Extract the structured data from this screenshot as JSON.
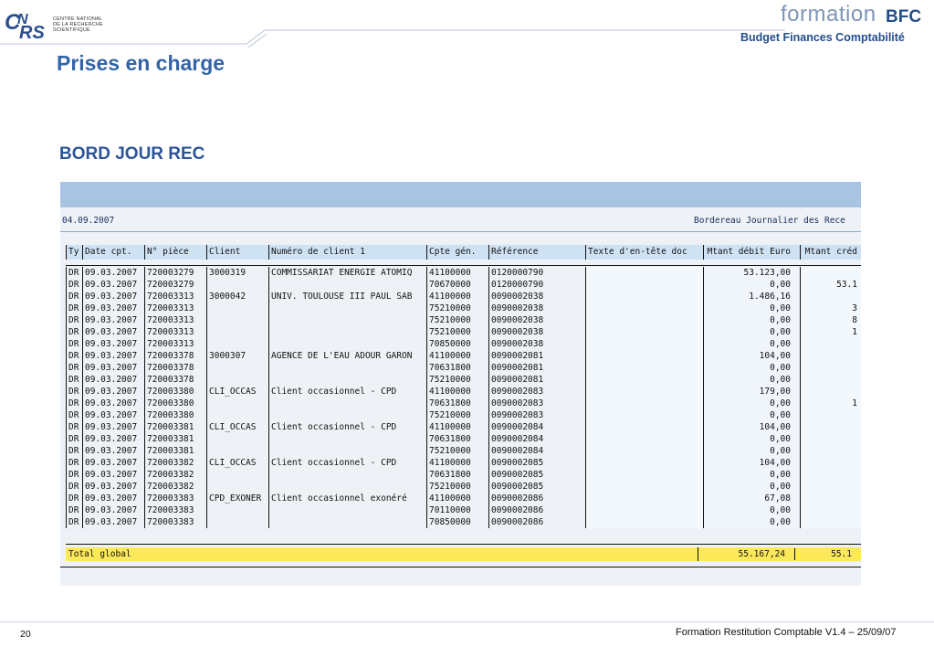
{
  "header": {
    "institution_lines": [
      "CENTRE NATIONAL",
      "DE LA RECHERCHE",
      "SCIENTIFIQUE"
    ],
    "brand_formation": "formation",
    "brand_bfc": "BFC",
    "brand_subtitle": "Budget Finances Comptabilité",
    "colors": {
      "brand_dark": "#234e8c",
      "brand_light": "#7f95b7",
      "title": "#3465a8"
    }
  },
  "slide_title": "Prises en charge",
  "section_title": "BORD JOUR REC",
  "sap": {
    "date": "04.09.2007",
    "report_title": "Bordereau Journalier des Rece",
    "columns": [
      "Ty",
      "Date cpt.",
      "N° pièce",
      "Client",
      "Numéro de client 1",
      "Cpte gén.",
      "Référence",
      "Texte d'en-tête doc",
      "Mtant débit Euro",
      "Mtant créd"
    ],
    "rows": [
      [
        "DR",
        "09.03.2007",
        "720003279",
        "3000319",
        "COMMISSARIAT ENERGIE ATOMIQ",
        "41100000",
        "0120000790",
        "",
        "53.123,00",
        ""
      ],
      [
        "DR",
        "09.03.2007",
        "720003279",
        "",
        "",
        "70670000",
        "0120000790",
        "",
        "0,00",
        "53.1"
      ],
      [
        "DR",
        "09.03.2007",
        "720003313",
        "3000042",
        "UNIV. TOULOUSE III PAUL SAB",
        "41100000",
        "0090002038",
        "",
        "1.486,16",
        ""
      ],
      [
        "DR",
        "09.03.2007",
        "720003313",
        "",
        "",
        "75210000",
        "0090002038",
        "",
        "0,00",
        "3"
      ],
      [
        "DR",
        "09.03.2007",
        "720003313",
        "",
        "",
        "75210000",
        "0090002038",
        "",
        "0,00",
        "8"
      ],
      [
        "DR",
        "09.03.2007",
        "720003313",
        "",
        "",
        "75210000",
        "0090002038",
        "",
        "0,00",
        "1"
      ],
      [
        "DR",
        "09.03.2007",
        "720003313",
        "",
        "",
        "70850000",
        "0090002038",
        "",
        "0,00",
        ""
      ],
      [
        "DR",
        "09.03.2007",
        "720003378",
        "3000307",
        "AGENCE DE L'EAU ADOUR GARON",
        "41100000",
        "0090002081",
        "",
        "104,00",
        ""
      ],
      [
        "DR",
        "09.03.2007",
        "720003378",
        "",
        "",
        "70631800",
        "0090002081",
        "",
        "0,00",
        ""
      ],
      [
        "DR",
        "09.03.2007",
        "720003378",
        "",
        "",
        "75210000",
        "0090002081",
        "",
        "0,00",
        ""
      ],
      [
        "DR",
        "09.03.2007",
        "720003380",
        "CLI_OCCAS",
        "Client occasionnel - CPD",
        "41100000",
        "0090002083",
        "",
        "179,00",
        ""
      ],
      [
        "DR",
        "09.03.2007",
        "720003380",
        "",
        "",
        "70631800",
        "0090002083",
        "",
        "0,00",
        "1"
      ],
      [
        "DR",
        "09.03.2007",
        "720003380",
        "",
        "",
        "75210000",
        "0090002083",
        "",
        "0,00",
        ""
      ],
      [
        "DR",
        "09.03.2007",
        "720003381",
        "CLI_OCCAS",
        "Client occasionnel - CPD",
        "41100000",
        "0090002084",
        "",
        "104,00",
        ""
      ],
      [
        "DR",
        "09.03.2007",
        "720003381",
        "",
        "",
        "70631800",
        "0090002084",
        "",
        "0,00",
        ""
      ],
      [
        "DR",
        "09.03.2007",
        "720003381",
        "",
        "",
        "75210000",
        "0090002084",
        "",
        "0,00",
        ""
      ],
      [
        "DR",
        "09.03.2007",
        "720003382",
        "CLI_OCCAS",
        "Client occasionnel - CPD",
        "41100000",
        "0090002085",
        "",
        "104,00",
        ""
      ],
      [
        "DR",
        "09.03.2007",
        "720003382",
        "",
        "",
        "70631800",
        "0090002085",
        "",
        "0,00",
        ""
      ],
      [
        "DR",
        "09.03.2007",
        "720003382",
        "",
        "",
        "75210000",
        "0090002085",
        "",
        "0,00",
        ""
      ],
      [
        "DR",
        "09.03.2007",
        "720003383",
        "CPD_EXONER",
        "Client occasionnel exonéré",
        "41100000",
        "0090002086",
        "",
        "67,08",
        ""
      ],
      [
        "DR",
        "09.03.2007",
        "720003383",
        "",
        "",
        "70110000",
        "0090002086",
        "",
        "0,00",
        ""
      ],
      [
        "DR",
        "09.03.2007",
        "720003383",
        "",
        "",
        "70850000",
        "0090002086",
        "",
        "0,00",
        ""
      ]
    ],
    "total": {
      "label": "Total global",
      "debit": "55.167,24",
      "credit": "55.1"
    },
    "colors": {
      "topbar": "#a9c3e3",
      "header_cell": "#cfe2f4",
      "total_bar": "#fbe95a"
    }
  },
  "footer": {
    "page_number": "20",
    "text": "Formation Restitution Comptable V1.4 – 25/09/07"
  }
}
